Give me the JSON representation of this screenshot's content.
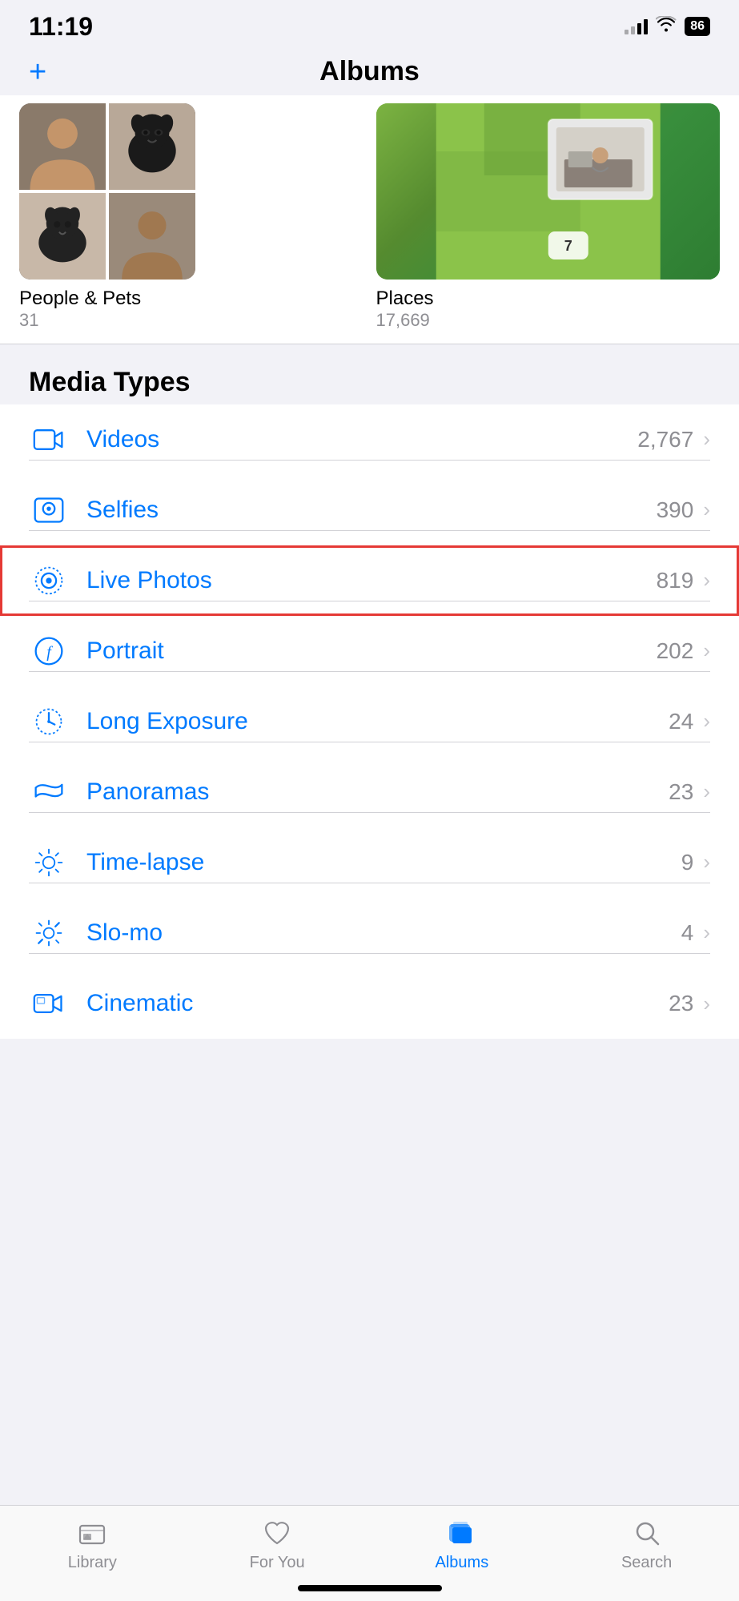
{
  "statusBar": {
    "time": "11:19",
    "battery": "86",
    "signalBars": [
      1,
      2,
      3,
      4
    ],
    "activeSignal": 2
  },
  "navBar": {
    "plusLabel": "+",
    "title": "Albums"
  },
  "albumCards": [
    {
      "name": "people-pets",
      "label": "People & Pets",
      "count": "31"
    },
    {
      "name": "places",
      "label": "Places",
      "count": "17,669"
    }
  ],
  "mediaTypes": {
    "sectionTitle": "Media Types",
    "items": [
      {
        "id": "videos",
        "icon": "video",
        "label": "Videos",
        "count": "2,767",
        "highlighted": false
      },
      {
        "id": "selfies",
        "icon": "selfie",
        "label": "Selfies",
        "count": "390",
        "highlighted": false
      },
      {
        "id": "live-photos",
        "icon": "live",
        "label": "Live Photos",
        "count": "819",
        "highlighted": true
      },
      {
        "id": "portrait",
        "icon": "portrait",
        "label": "Portrait",
        "count": "202",
        "highlighted": false
      },
      {
        "id": "long-exposure",
        "icon": "long-exposure",
        "label": "Long Exposure",
        "count": "24",
        "highlighted": false
      },
      {
        "id": "panoramas",
        "icon": "panorama",
        "label": "Panoramas",
        "count": "23",
        "highlighted": false
      },
      {
        "id": "time-lapse",
        "icon": "timelapse",
        "label": "Time-lapse",
        "count": "9",
        "highlighted": false
      },
      {
        "id": "slo-mo",
        "icon": "slomo",
        "label": "Slo-mo",
        "count": "4",
        "highlighted": false
      },
      {
        "id": "cinematic",
        "icon": "cinematic",
        "label": "Cinematic",
        "count": "23",
        "highlighted": false
      }
    ]
  },
  "tabBar": {
    "items": [
      {
        "id": "library",
        "label": "Library",
        "active": false
      },
      {
        "id": "for-you",
        "label": "For You",
        "active": false
      },
      {
        "id": "albums",
        "label": "Albums",
        "active": true
      },
      {
        "id": "search",
        "label": "Search",
        "active": false
      }
    ]
  }
}
